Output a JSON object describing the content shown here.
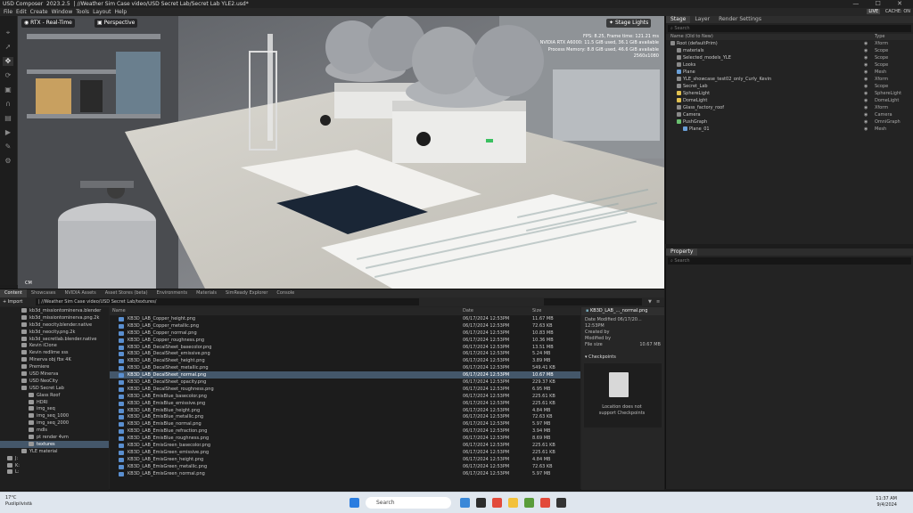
{
  "window": {
    "app": "USD Composer",
    "version": "2023.2.5",
    "path": "| //Weather Sim Case video/USD Secret Lab/Secret Lab YLE2.usd*"
  },
  "menu": [
    "File",
    "Edit",
    "Create",
    "Window",
    "Tools",
    "Layout",
    "Help"
  ],
  "menu_right": {
    "live": "LIVE",
    "cache": "CACHE: ON"
  },
  "viewport": {
    "render_mode": "RTX - Real-Time",
    "camera": "Perspective",
    "stage_lights": "Stage Lights",
    "resolution_hint": "CM",
    "stats": [
      "FPS: 8.25, Frame time: 121.21 ms",
      "NVIDIA RTX A6000: 11.5 GiB used, 36.1 GiB available",
      "Process Memory: 8.8 GiB used, 46.6 GiB available",
      "2560x1080"
    ]
  },
  "stage": {
    "tabs": [
      "Stage",
      "Layer",
      "Render Settings"
    ],
    "search_placeholder": "Search",
    "col_name": "Name (Old to New)",
    "col_type": "Type",
    "rows": [
      {
        "name": "Root (defaultPrim)",
        "type": "Xform",
        "indent": 0,
        "color": "#8a8a8a"
      },
      {
        "name": "materials",
        "type": "Scope",
        "indent": 1,
        "color": "#8a8a8a"
      },
      {
        "name": "Selected_models_YLE",
        "type": "Scope",
        "indent": 1,
        "color": "#8a8a8a"
      },
      {
        "name": "Looks",
        "type": "Scope",
        "indent": 1,
        "color": "#8a8a8a"
      },
      {
        "name": "Plane",
        "type": "Mesh",
        "indent": 1,
        "color": "#6aa0d8"
      },
      {
        "name": "YLE_showcase_test02_only_Curly_Kevin",
        "type": "Xform",
        "indent": 1,
        "color": "#8a8a8a"
      },
      {
        "name": "Secret_Lab",
        "type": "Scope",
        "indent": 1,
        "color": "#8a8a8a"
      },
      {
        "name": "SphereLight",
        "type": "SphereLight",
        "indent": 1,
        "color": "#e0c050"
      },
      {
        "name": "DomeLight",
        "type": "DomeLight",
        "indent": 1,
        "color": "#e0c050"
      },
      {
        "name": "Glass_factory_roof",
        "type": "Xform",
        "indent": 1,
        "color": "#8a8a8a"
      },
      {
        "name": "Camera",
        "type": "Camera",
        "indent": 1,
        "color": "#8a8a8a"
      },
      {
        "name": "PushGraph",
        "type": "OmniGraph",
        "indent": 1,
        "color": "#6ac070"
      },
      {
        "name": "Plane_01",
        "type": "Mesh",
        "indent": 2,
        "color": "#6aa0d8"
      }
    ]
  },
  "property": {
    "tab": "Property",
    "search_placeholder": "Search"
  },
  "bottom": {
    "tabs": [
      "Content",
      "Showcases",
      "NVIDIA Assets",
      "Asset Stores (beta)",
      "Environments",
      "Materials",
      "SimReady Explorer",
      "Console"
    ],
    "import_label": "Import",
    "path": "| //Weather Sim Case video/USD Secret Lab/textures/",
    "tree": [
      {
        "name": "kb3d_missiontominerva.blender",
        "indent": 2
      },
      {
        "name": "kb3d_missiontominerva.png.2k",
        "indent": 2
      },
      {
        "name": "kb3d_neocity.blender.native",
        "indent": 2
      },
      {
        "name": "kb3d_neocity.png.2k",
        "indent": 2
      },
      {
        "name": "kb3d_secretlab.blender.native",
        "indent": 2
      },
      {
        "name": "Kevin iClone",
        "indent": 2
      },
      {
        "name": "Kevin redlime sss",
        "indent": 2
      },
      {
        "name": "Minerva obj fbx 4K",
        "indent": 2
      },
      {
        "name": "Premiere",
        "indent": 2
      },
      {
        "name": "USD Minerva",
        "indent": 2
      },
      {
        "name": "USD NeoCity",
        "indent": 2
      },
      {
        "name": "USD Secret Lab",
        "indent": 2
      },
      {
        "name": "Glass Roof",
        "indent": 3
      },
      {
        "name": "HDRI",
        "indent": 3
      },
      {
        "name": "img_seq",
        "indent": 3
      },
      {
        "name": "img_seq_1000",
        "indent": 3
      },
      {
        "name": "img_seq_2000",
        "indent": 3
      },
      {
        "name": "mdls",
        "indent": 3
      },
      {
        "name": "pt render 4vm",
        "indent": 3
      },
      {
        "name": "textures",
        "indent": 3,
        "selected": true
      },
      {
        "name": "YLE material",
        "indent": 2
      },
      {
        "name": "J:",
        "indent": 0
      },
      {
        "name": "K:",
        "indent": 0
      },
      {
        "name": "L:",
        "indent": 0
      }
    ],
    "file_cols": {
      "name": "Name",
      "date": "Date",
      "size": "Size"
    },
    "files": [
      {
        "name": "KB3D_LAB_Copper_height.png",
        "date": "06/17/2024 12:53PM",
        "size": "11.67 MB"
      },
      {
        "name": "KB3D_LAB_Copper_metallic.png",
        "date": "06/17/2024 12:53PM",
        "size": "72.63 KB"
      },
      {
        "name": "KB3D_LAB_Copper_normal.png",
        "date": "06/17/2024 12:53PM",
        "size": "10.83 MB"
      },
      {
        "name": "KB3D_LAB_Copper_roughness.png",
        "date": "06/17/2024 12:53PM",
        "size": "10.36 MB"
      },
      {
        "name": "KB3D_LAB_DecalSheet_basecolor.png",
        "date": "06/17/2024 12:53PM",
        "size": "13.51 MB"
      },
      {
        "name": "KB3D_LAB_DecalSheet_emissive.png",
        "date": "06/17/2024 12:53PM",
        "size": "5.24 MB"
      },
      {
        "name": "KB3D_LAB_DecalSheet_height.png",
        "date": "06/17/2024 12:53PM",
        "size": "3.89 MB"
      },
      {
        "name": "KB3D_LAB_DecalSheet_metallic.png",
        "date": "06/17/2024 12:53PM",
        "size": "549.41 KB"
      },
      {
        "name": "KB3D_LAB_DecalSheet_normal.png",
        "date": "06/17/2024 12:53PM",
        "size": "10.67 MB",
        "selected": true
      },
      {
        "name": "KB3D_LAB_DecalSheet_opacity.png",
        "date": "06/17/2024 12:53PM",
        "size": "229.37 KB"
      },
      {
        "name": "KB3D_LAB_DecalSheet_roughness.png",
        "date": "06/17/2024 12:53PM",
        "size": "6.95 MB"
      },
      {
        "name": "KB3D_LAB_EmisBlue_basecolor.png",
        "date": "06/17/2024 12:53PM",
        "size": "225.61 KB"
      },
      {
        "name": "KB3D_LAB_EmisBlue_emissive.png",
        "date": "06/17/2024 12:53PM",
        "size": "225.61 KB"
      },
      {
        "name": "KB3D_LAB_EmisBlue_height.png",
        "date": "06/17/2024 12:53PM",
        "size": "4.84 MB"
      },
      {
        "name": "KB3D_LAB_EmisBlue_metallic.png",
        "date": "06/17/2024 12:53PM",
        "size": "72.63 KB"
      },
      {
        "name": "KB3D_LAB_EmisBlue_normal.png",
        "date": "06/17/2024 12:53PM",
        "size": "5.97 MB"
      },
      {
        "name": "KB3D_LAB_EmisBlue_refraction.png",
        "date": "06/17/2024 12:53PM",
        "size": "3.94 MB"
      },
      {
        "name": "KB3D_LAB_EmisBlue_roughness.png",
        "date": "06/17/2024 12:53PM",
        "size": "8.69 MB"
      },
      {
        "name": "KB3D_LAB_EmisGreen_basecolor.png",
        "date": "06/17/2024 12:53PM",
        "size": "225.61 KB"
      },
      {
        "name": "KB3D_LAB_EmisGreen_emissive.png",
        "date": "06/17/2024 12:53PM",
        "size": "225.61 KB"
      },
      {
        "name": "KB3D_LAB_EmisGreen_height.png",
        "date": "06/17/2024 12:53PM",
        "size": "4.84 MB"
      },
      {
        "name": "KB3D_LAB_EmisGreen_metallic.png",
        "date": "06/17/2024 12:53PM",
        "size": "72.63 KB"
      },
      {
        "name": "KB3D_LAB_EmisGreen_normal.png",
        "date": "06/17/2024 12:53PM",
        "size": "5.97 MB"
      }
    ],
    "detail": {
      "title": "KB3D_LAB_..._normal.png",
      "modified_label": "Date Modified",
      "modified_value": "06/17/20... 12:53PM",
      "created_label": "Created by",
      "modified_by_label": "Modified by",
      "size_label": "File size",
      "size_value": "10.67 MB",
      "checkpoints": "Checkpoints",
      "no_checkpoints": "Location does not support Checkpoints"
    }
  },
  "taskbar": {
    "weather_temp": "17°C",
    "weather_desc": "Puolipilvistä",
    "search": "Search",
    "time": "11:37 AM",
    "date": "9/4/2024"
  }
}
